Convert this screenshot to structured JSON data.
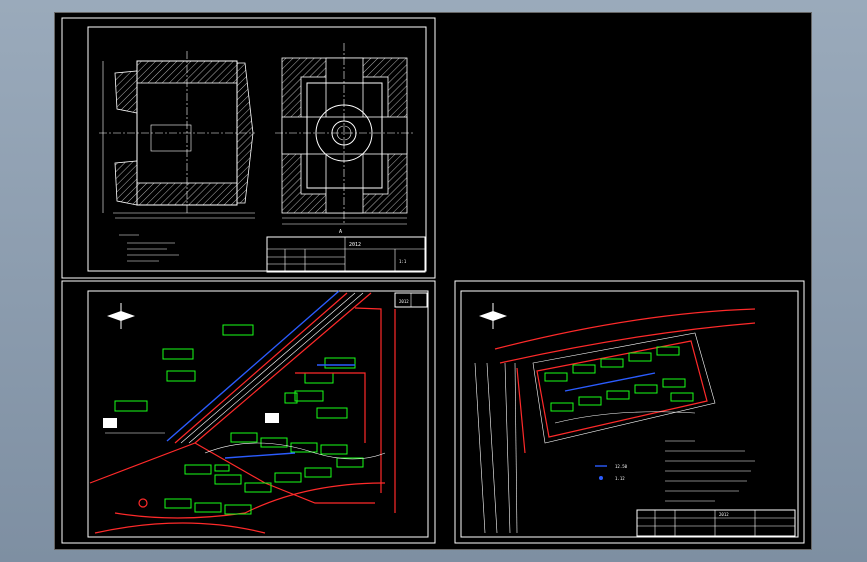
{
  "sheet_top": {
    "title_block": {
      "drawing_no": "2012",
      "name": "",
      "scale": "1:1"
    },
    "section_mark": "A"
  },
  "sheet_left": {
    "title_block": {
      "drawing_no": "2012",
      "name": ""
    }
  },
  "sheet_right": {
    "title_block": {
      "drawing_no": "2012",
      "name": ""
    },
    "legend_values": [
      "12.50",
      "1.12"
    ]
  },
  "colors": {
    "canvas": "#000000",
    "line": "#ffffff",
    "road": "#ff2a2a",
    "building": "#19ff19",
    "water": "#2b5cff"
  }
}
